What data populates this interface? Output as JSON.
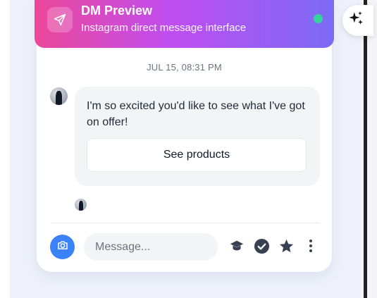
{
  "header": {
    "title": "DM Preview",
    "subtitle": "Instagram direct message interface",
    "icon": "paper-plane-icon",
    "status": "online",
    "gradient": [
      "#ec4899",
      "#7b6bf5"
    ],
    "status_color": "#34d399"
  },
  "conversation": {
    "timestamp": "JUL 15, 08:31 PM",
    "message": {
      "text": "I'm so excited you'd like to see what I've got on offer!",
      "button_label": "See products"
    }
  },
  "composer": {
    "placeholder": "Message...",
    "camera_icon": "camera-icon",
    "accent": "#3b82f6",
    "tools": [
      "graduation-cap-icon",
      "check-circle-icon",
      "star-icon",
      "more-vertical-icon"
    ]
  },
  "side_panel": {
    "icon": "sparkles-icon"
  }
}
